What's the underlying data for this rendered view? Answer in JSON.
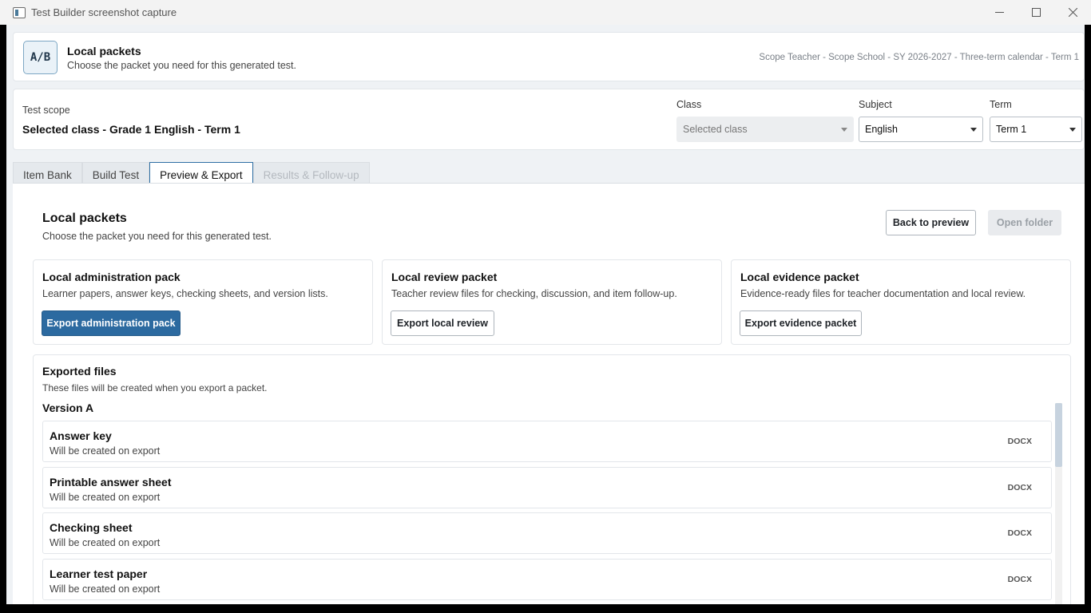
{
  "window": {
    "title": "Test Builder screenshot capture"
  },
  "header": {
    "logo_text": "A/B",
    "title": "Local packets",
    "subtitle": "Choose the packet you need for this generated test.",
    "context": "Scope Teacher - Scope School - SY 2026-2027 - Three-term calendar - Term 1"
  },
  "scope": {
    "label": "Test scope",
    "value": "Selected class - Grade 1 English - Term 1",
    "class_label": "Class",
    "class_value": "Selected class",
    "subject_label": "Subject",
    "subject_value": "English",
    "term_label": "Term",
    "term_value": "Term 1"
  },
  "tabs": [
    {
      "label": "Item Bank",
      "state": "normal"
    },
    {
      "label": "Build Test",
      "state": "normal"
    },
    {
      "label": "Preview & Export",
      "state": "active"
    },
    {
      "label": "Results & Follow-up",
      "state": "disabled"
    }
  ],
  "panel": {
    "title": "Local packets",
    "subtitle": "Choose the packet you need for this generated test.",
    "back_button": "Back to preview",
    "open_folder_button": "Open folder"
  },
  "packs": [
    {
      "title": "Local administration pack",
      "desc": "Learner papers, answer keys, checking sheets, and version lists.",
      "button": "Export administration pack"
    },
    {
      "title": "Local review packet",
      "desc": "Teacher review files for checking, discussion, and item follow-up.",
      "button": "Export local review"
    },
    {
      "title": "Local evidence packet",
      "desc": "Evidence-ready files for teacher documentation and local review.",
      "button": "Export evidence packet"
    }
  ],
  "files": {
    "title": "Exported files",
    "subtitle": "These files will be created when you export a packet.",
    "version": "Version A",
    "rows": [
      {
        "name": "Answer key",
        "status": "Will be created on export",
        "type": "DOCX"
      },
      {
        "name": "Printable answer sheet",
        "status": "Will be created on export",
        "type": "DOCX"
      },
      {
        "name": "Checking sheet",
        "status": "Will be created on export",
        "type": "DOCX"
      },
      {
        "name": "Learner test paper",
        "status": "Will be created on export",
        "type": "DOCX"
      }
    ]
  },
  "colors": {
    "accent": "#2c6aa0",
    "background": "#eff2f5"
  }
}
